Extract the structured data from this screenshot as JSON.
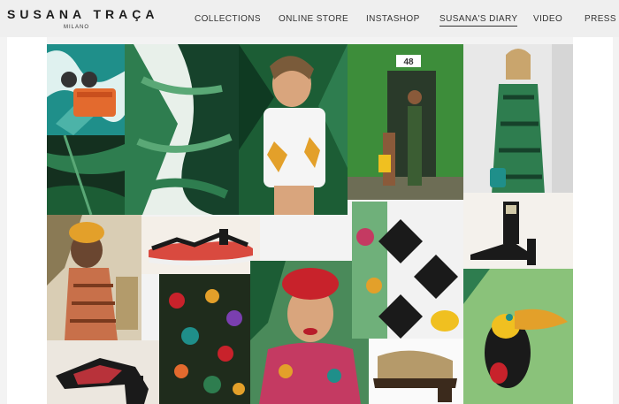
{
  "brand": {
    "name": "SUSANA TRAÇA",
    "sub": "MILANO"
  },
  "nav": {
    "items": [
      {
        "label": "COLLECTIONS",
        "active": false
      },
      {
        "label": "ONLINE STORE",
        "active": false
      },
      {
        "label": "INSTASHOP",
        "active": false
      },
      {
        "label": "SUSANA'S DIARY",
        "active": true
      },
      {
        "label": "VIDEO",
        "active": false
      },
      {
        "label": "PRESS",
        "active": false
      }
    ]
  },
  "collage": {
    "sign_text": "48",
    "colors": {
      "leaf": "#2e7d4f",
      "darkleaf": "#16422b",
      "teal": "#1f8f8a",
      "orange": "#e36a2e",
      "yellow": "#f0c020",
      "red": "#c8222b"
    }
  }
}
